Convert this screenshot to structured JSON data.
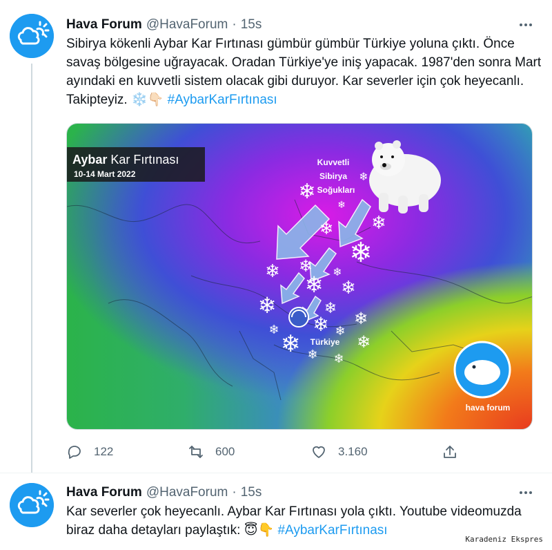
{
  "tweets": [
    {
      "author_name": "Hava Forum",
      "handle": "@HavaForum",
      "separator": "·",
      "time": "15s",
      "text_segments": [
        "Sibirya kökenli Aybar Kar Fırtınası gümbür gümbür Türkiye yoluna çıktı. Önce savaş bölgesine uğrayacak. Oradan Türkiye'ye iniş yapacak. 1987'den sonra Mart ayındaki en kuvvetli sistem olacak gibi duruyor. Kar severler için çok heyecanlı. Takipteyiz. ",
        "❄️👇🏻",
        "#AybarKarFırtınası"
      ],
      "media": {
        "title_bold": "Aybar",
        "title_rest": " Kar Fırtınası",
        "date": "10-14 Mart 2022",
        "label_kuvvetli": "Kuvvetli",
        "label_sibirya": "Sibirya",
        "label_soguklari": "Soğukları",
        "label_turkiye": "Türkiye",
        "brand": "hava forum"
      },
      "actions": {
        "reply_count": "122",
        "retweet_count": "600",
        "like_count": "3.160"
      }
    },
    {
      "author_name": "Hava Forum",
      "handle": "@HavaForum",
      "separator": "·",
      "time": "15s",
      "text_segments": [
        "Kar severler çok heyecanlı. Aybar Kar Fırtınası yola çıktı. Youtube videomuzda biraz daha detayları paylaştık: ",
        "😇👇",
        "#AybarKarFırtınası"
      ]
    }
  ],
  "watermark": "Karadeniz Ekspres",
  "colors": {
    "brand_blue": "#1d9bf0",
    "text_primary": "#0f1419",
    "text_secondary": "#536471"
  },
  "icons": [
    "cloud-sun-avatar-icon",
    "more-icon",
    "reply-icon",
    "retweet-icon",
    "like-icon",
    "share-icon"
  ]
}
